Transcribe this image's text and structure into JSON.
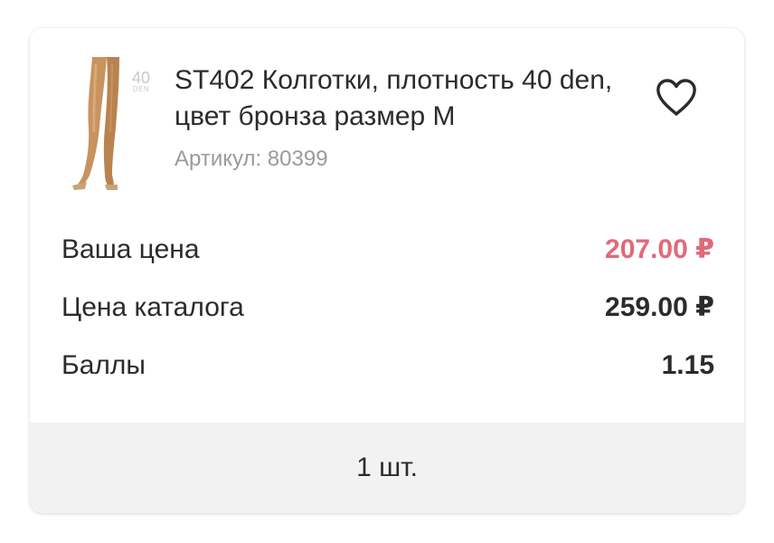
{
  "product": {
    "title": "ST402 Колготки, плотность 40 den, цвет бронза размер M",
    "sku": "Артикул: 80399",
    "image_badge_number": "40",
    "image_badge_unit": "DEN",
    "image_icon": "tights-product-image",
    "favorite_icon": "heart-outline-icon"
  },
  "prices": [
    {
      "label": "Ваша цена",
      "value": "207.00 ₽",
      "accent": true
    },
    {
      "label": "Цена каталога",
      "value": "259.00 ₽",
      "accent": false
    },
    {
      "label": "Баллы",
      "value": "1.15",
      "accent": false
    }
  ],
  "quantity": {
    "label": "1 шт."
  },
  "colors": {
    "accent_price": "#e06a7b",
    "text": "#2b2b2b",
    "muted": "#9a9a9a",
    "footer_bg": "#f2f2f2"
  }
}
